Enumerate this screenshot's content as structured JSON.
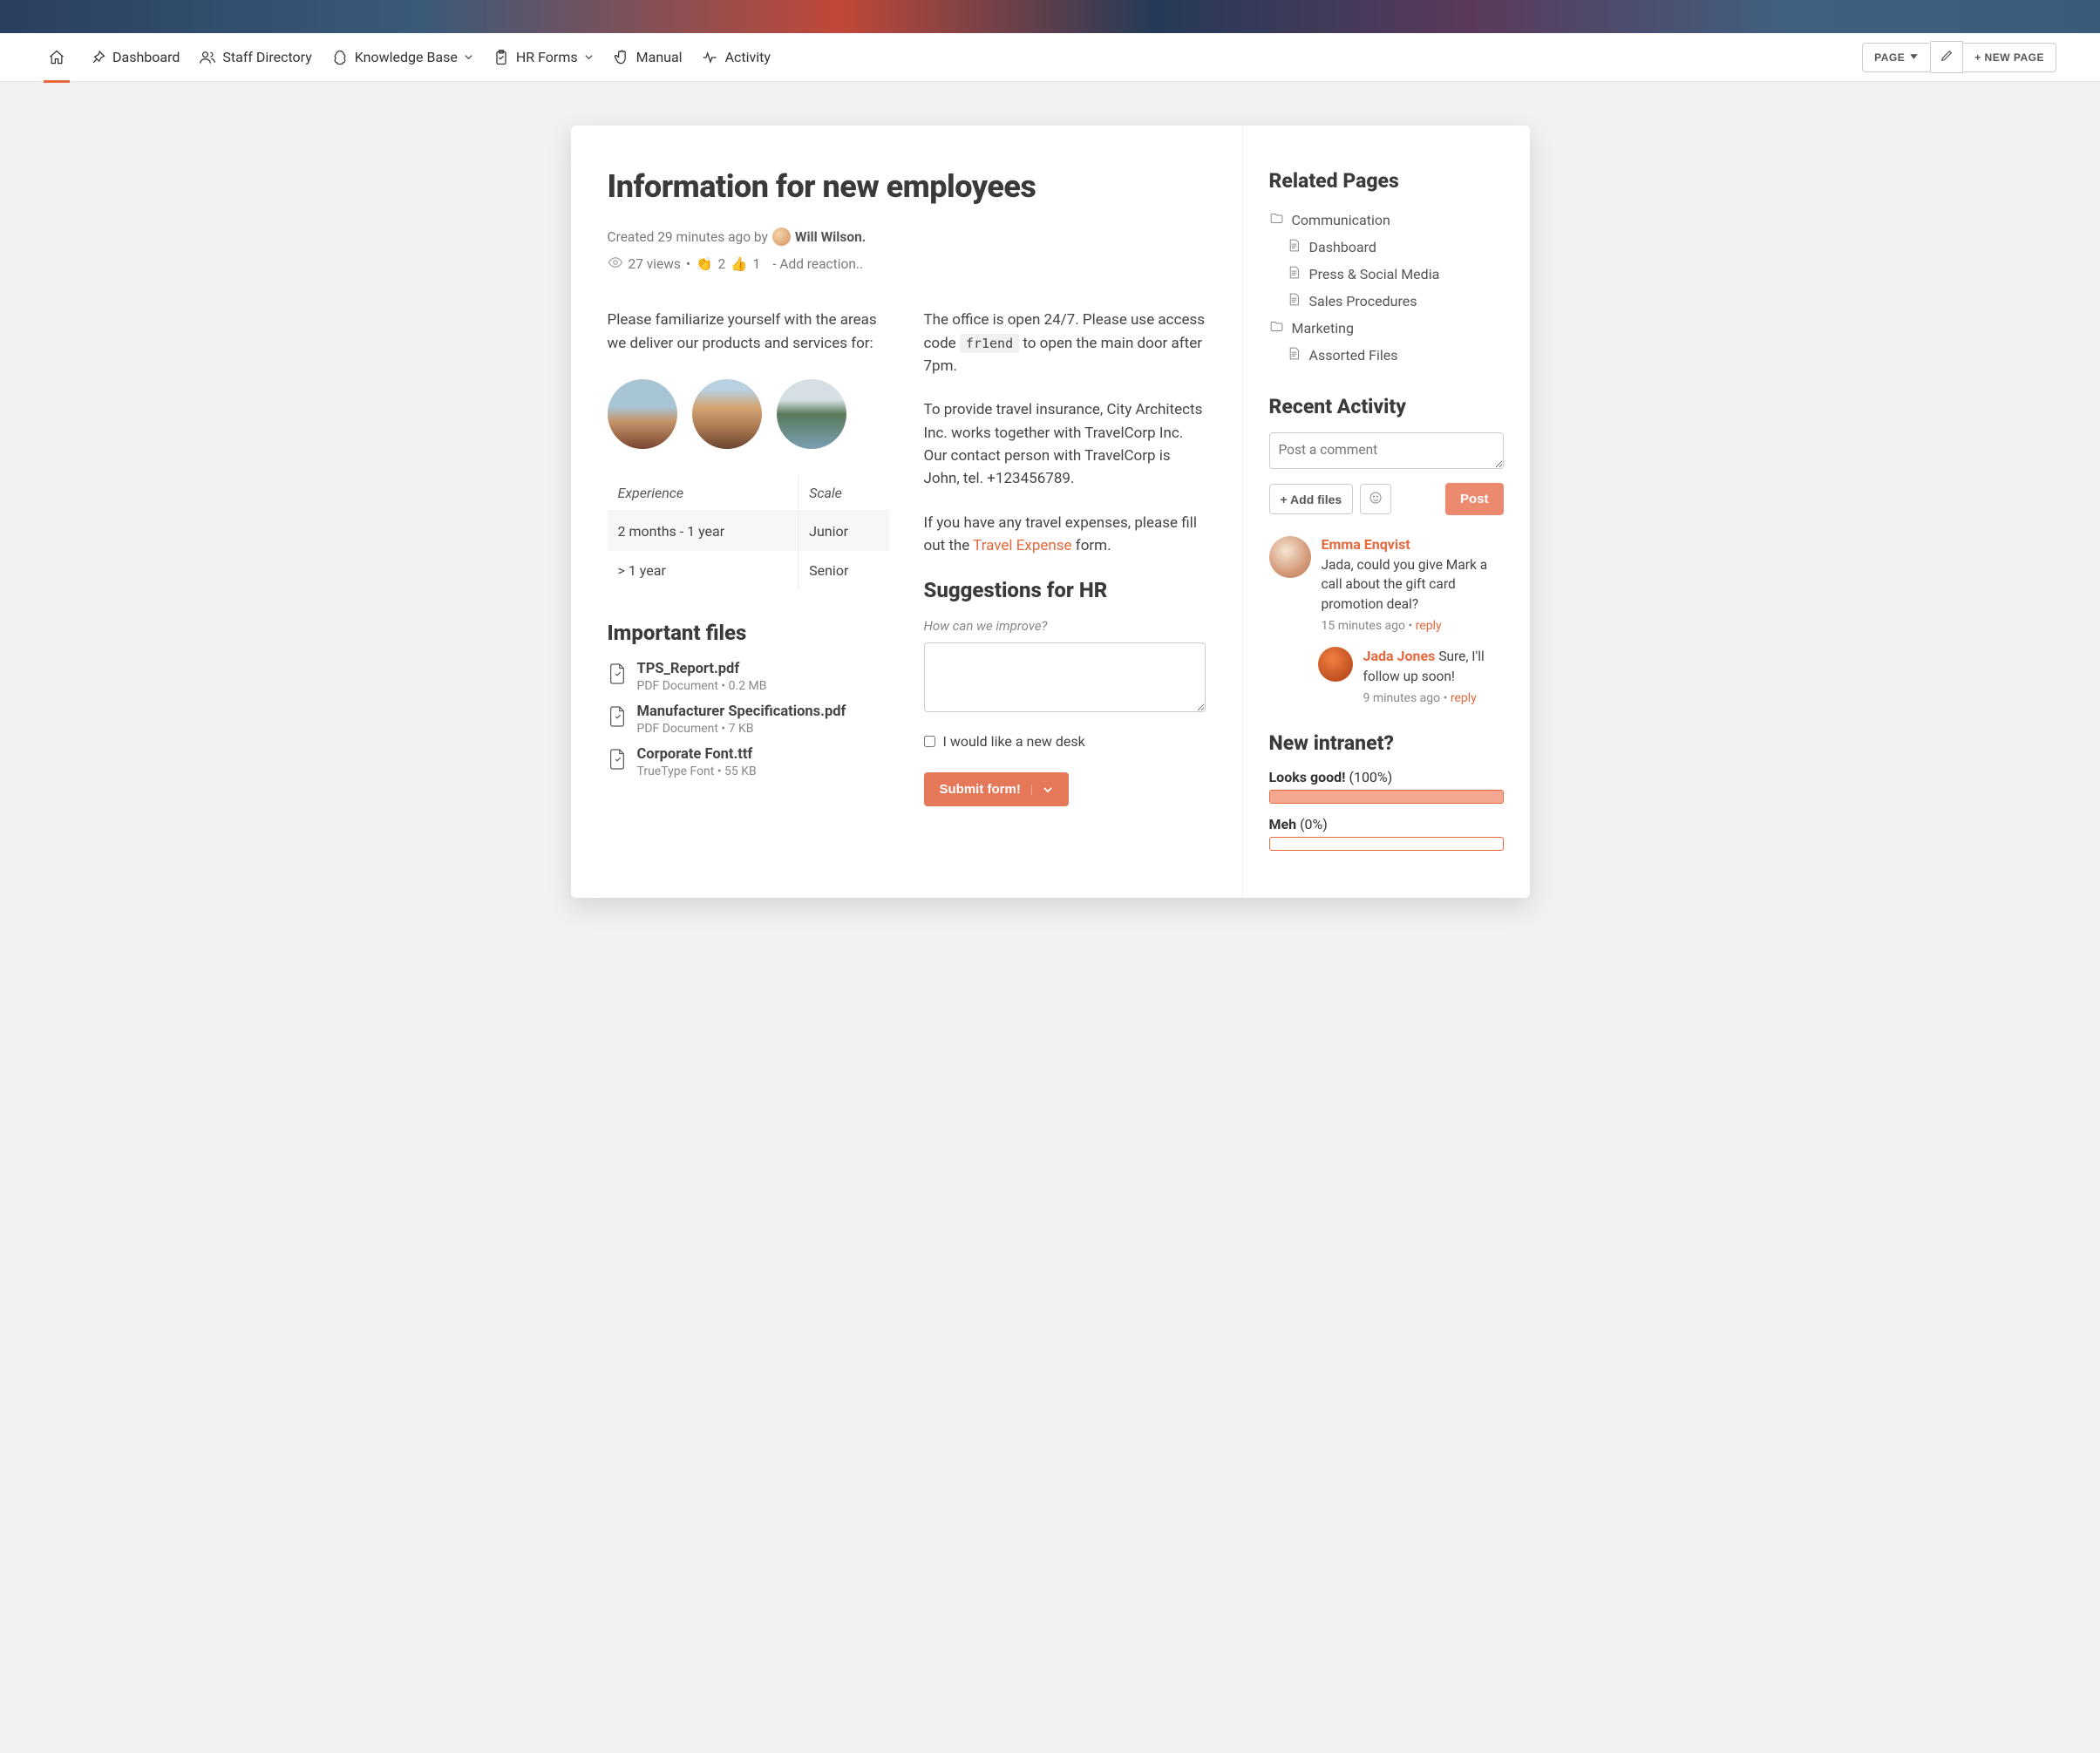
{
  "nav": {
    "items": [
      {
        "label": "",
        "icon": "home"
      },
      {
        "label": "Dashboard",
        "icon": "pushpin"
      },
      {
        "label": "Staff Directory",
        "icon": "users"
      },
      {
        "label": "Knowledge Base",
        "icon": "brain",
        "hasDropdown": true
      },
      {
        "label": "HR Forms",
        "icon": "clipboard",
        "hasDropdown": true
      },
      {
        "label": "Manual",
        "icon": "hand"
      },
      {
        "label": "Activity",
        "icon": "heartbeat"
      }
    ],
    "pageBtn": "PAGE",
    "newPageBtn": "+ NEW PAGE"
  },
  "page": {
    "title": "Information for new employees",
    "created": "Created 29 minutes ago by",
    "author": "Will Wilson",
    "viewsCount": "27 views",
    "clapCount": "2",
    "thumbCount": "1",
    "addReaction": "- Add reaction.."
  },
  "content": {
    "intro": "Please familiarize yourself with the areas we deliver our products and services for:",
    "tableHead": [
      "Experience",
      "Scale"
    ],
    "tableRows": [
      [
        "2 months - 1 year",
        "Junior"
      ],
      [
        "> 1 year",
        "Senior"
      ]
    ],
    "importantFilesTitle": "Important files",
    "files": [
      {
        "name": "TPS_Report.pdf",
        "meta": "PDF Document • 0.2 MB"
      },
      {
        "name": "Manufacturer Specifications.pdf",
        "meta": "PDF Document • 7 KB"
      },
      {
        "name": "Corporate Font.ttf",
        "meta": "TrueType Font • 55 KB"
      }
    ],
    "office1a": "The office is open 24/7. Please use access code ",
    "officeCode": "fr1end",
    "office1b": " to open the main door after 7pm.",
    "office2": "To provide travel insurance, City Architects Inc. works together with TravelCorp Inc. Our contact person with TravelCorp is John, tel. +123456789.",
    "office3a": "If you have any travel expenses, please fill out the ",
    "travelLink": "Travel Expense",
    "office3b": " form.",
    "suggTitle": "Suggestions for HR",
    "suggHint": "How can we improve?",
    "deskCheckbox": "I would like a new desk",
    "submitBtn": "Submit form!"
  },
  "sidebar": {
    "relatedTitle": "Related Pages",
    "related": [
      {
        "type": "folder",
        "label": "Communication"
      },
      {
        "type": "page",
        "label": "Dashboard"
      },
      {
        "type": "page",
        "label": "Press & Social Media"
      },
      {
        "type": "page",
        "label": "Sales Procedures"
      },
      {
        "type": "folder",
        "label": "Marketing"
      },
      {
        "type": "page",
        "label": "Assorted Files"
      }
    ],
    "activityTitle": "Recent Activity",
    "commentPlaceholder": "Post a comment",
    "addFilesBtn": "+ Add files",
    "postBtn": "Post",
    "comments": [
      {
        "author": "Emma Enqvist",
        "text": "Jada, could you give Mark a call about the gift card promotion deal?",
        "time": "15 minutes ago",
        "reply": {
          "author": "Jada Jones",
          "text": "Sure, I'll follow up soon!",
          "time": "9 minutes ago"
        }
      }
    ],
    "pollTitle": "New intranet?",
    "pollOptions": [
      {
        "label": "Looks good!",
        "percentText": "(100%)",
        "percent": 100
      },
      {
        "label": "Meh",
        "percentText": "(0%)",
        "percent": 0
      }
    ],
    "replyLabel": "reply"
  }
}
